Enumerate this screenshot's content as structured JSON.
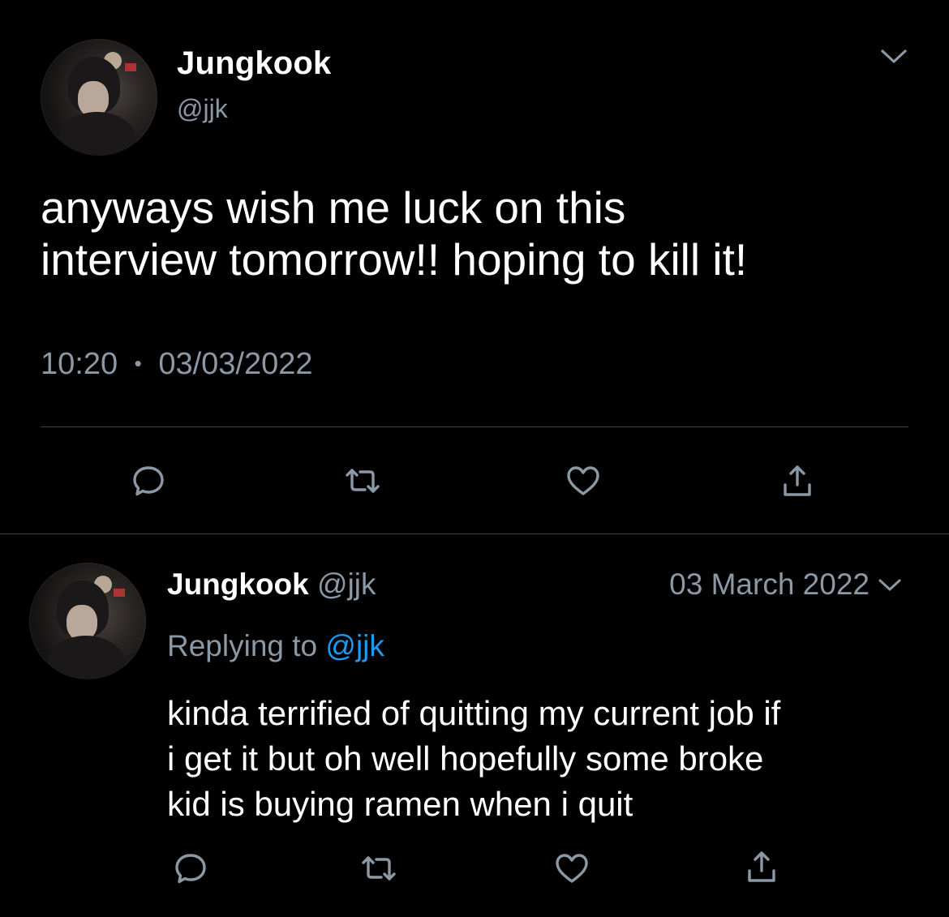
{
  "main_tweet": {
    "display_name": "Jungkook",
    "handle": "@jjk",
    "text_line1": "anyways wish me luck on this",
    "text_line2": "interview tomorrow!! hoping to kill it!",
    "time": "10:20",
    "separator": "•",
    "date": "03/03/2022"
  },
  "reply_tweet": {
    "display_name": "Jungkook",
    "handle": "@jjk",
    "date": "03 March 2022",
    "replying_prefix": "Replying to",
    "replying_handle": "@jjk",
    "text_line1": "kinda terrified of quitting my current job if",
    "text_line2": "i get it but oh well hopefully some broke",
    "text_line3": "kid is buying ramen when i quit"
  },
  "actions": {
    "icons": [
      "reply-icon",
      "retweet-icon",
      "like-icon",
      "share-icon"
    ]
  },
  "colors": {
    "background": "#000000",
    "text": "#ffffff",
    "secondary": "#8b98a5",
    "link": "#1d9bf0",
    "divider": "#38444d"
  }
}
